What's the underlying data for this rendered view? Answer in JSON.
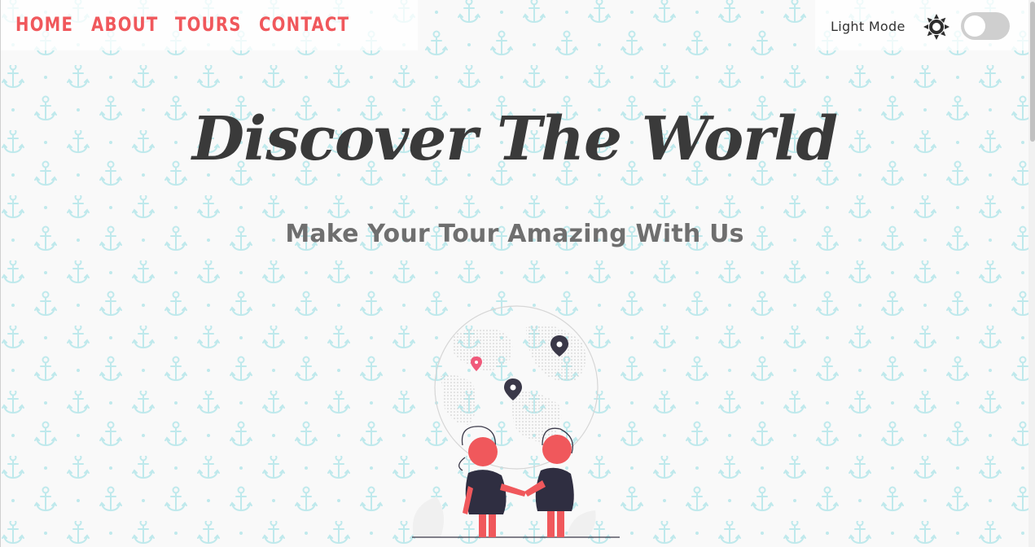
{
  "nav": {
    "links": [
      "HOME",
      "ABOUT",
      "TOURS",
      "CONTACT"
    ]
  },
  "theme_toggle": {
    "label": "Light Mode",
    "icon": "sun-icon",
    "checked": false
  },
  "hero": {
    "title": "Discover The World",
    "subtitle": "Make Your Tour Amazing With Us"
  },
  "colors": {
    "accent": "#f0585c",
    "anchor_pattern": "#bfe9ec",
    "title": "#3a3a3a",
    "subtitle": "#6f6f6f",
    "background": "#f9f9f9"
  }
}
